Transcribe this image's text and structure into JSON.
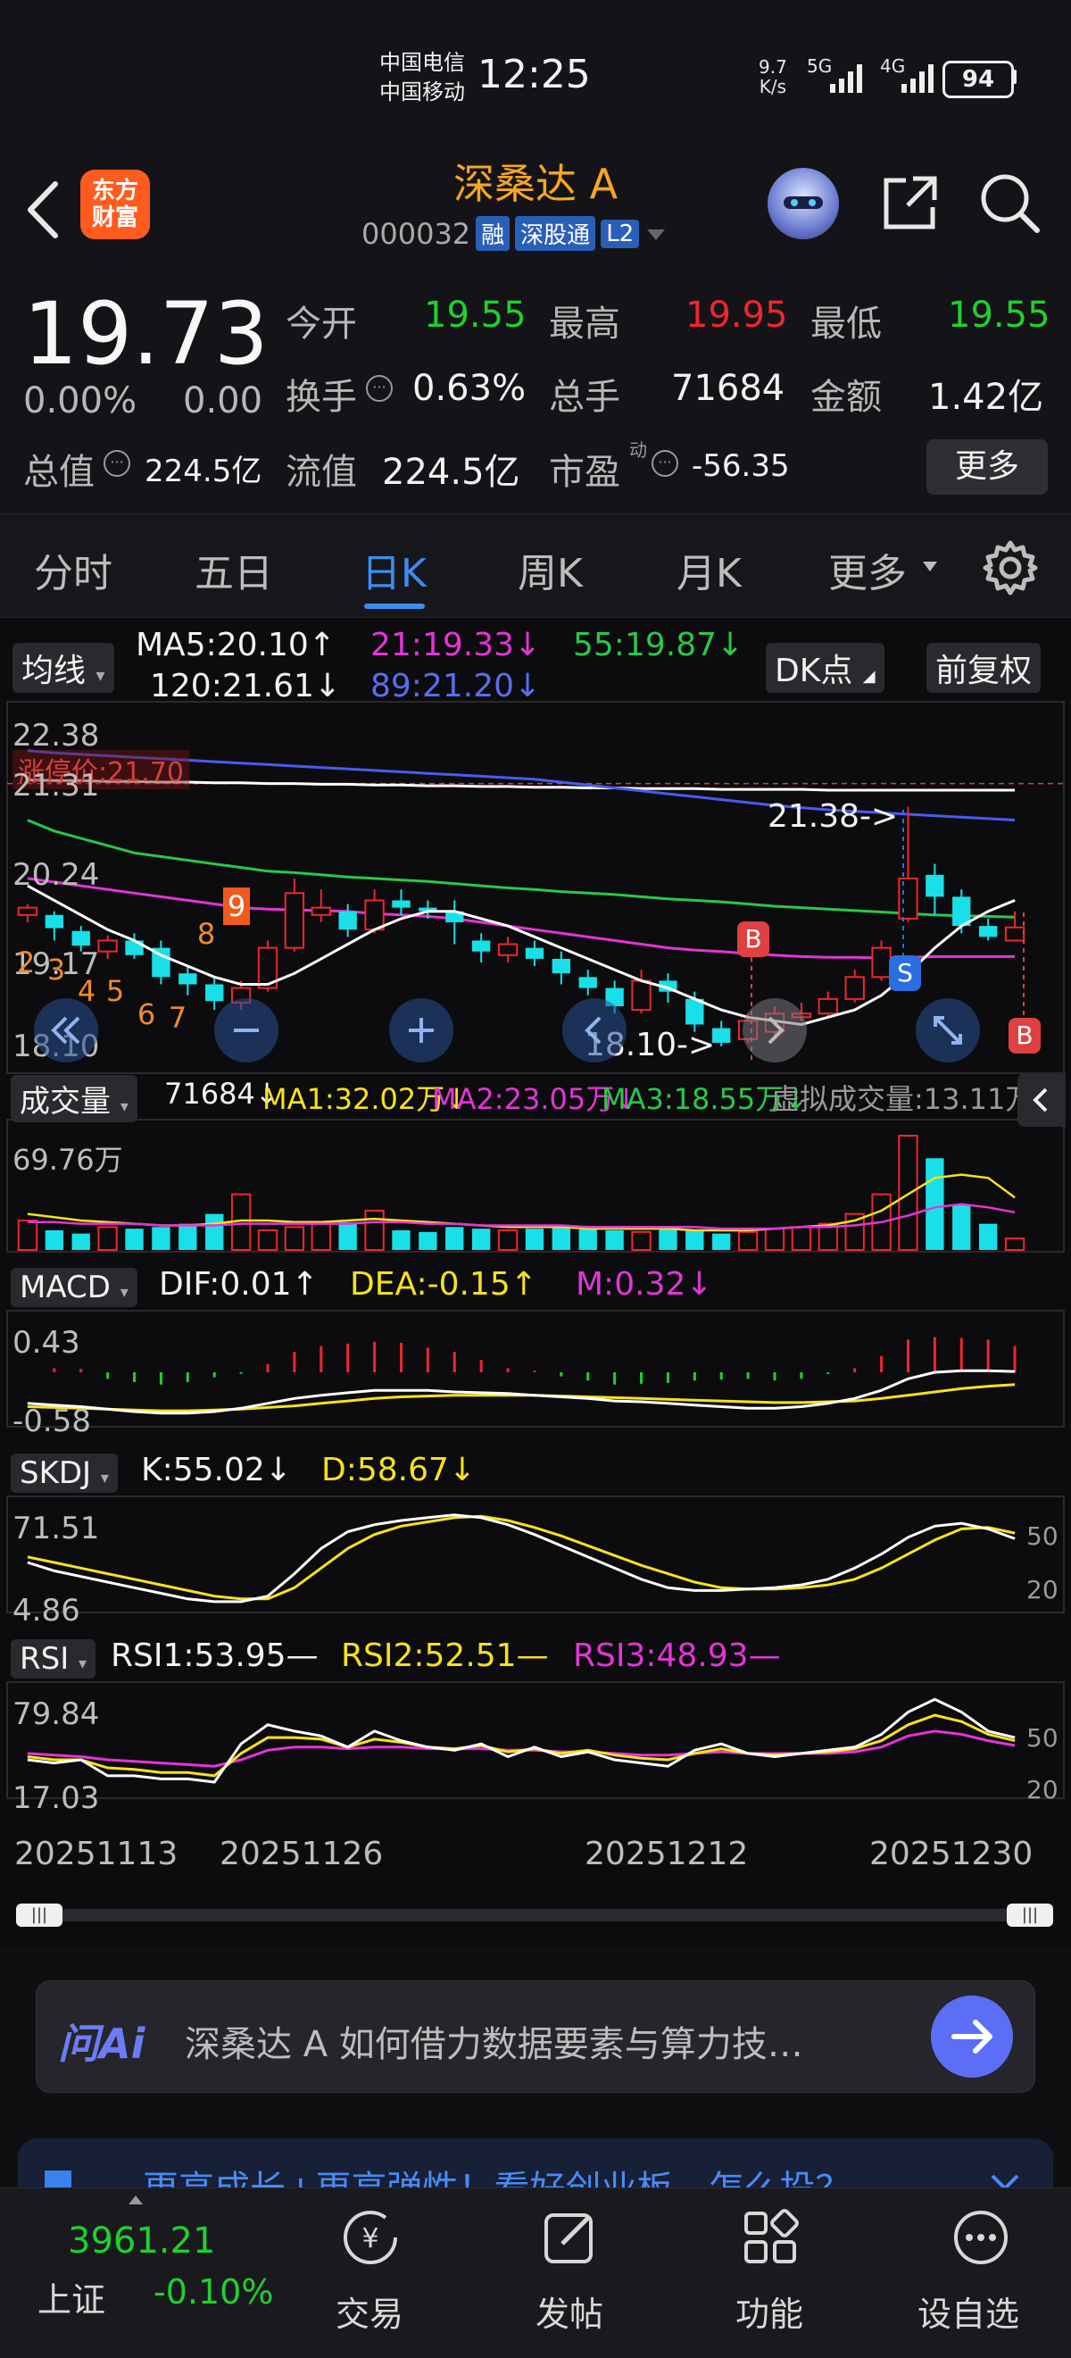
{
  "status": {
    "carrier1": "中国电信",
    "carrier2": "中国移动",
    "time": "12:25",
    "speed_top": "9.7",
    "speed_bottom": "K/s",
    "net1": "5G",
    "net2": "4G",
    "battery": "94"
  },
  "header": {
    "back_icon": "chevron-left-icon",
    "logo_line1": "东方",
    "logo_line2": "财富",
    "title": "深桑达 A",
    "code": "000032",
    "tags": [
      "融",
      "深股通",
      "L2"
    ]
  },
  "quote": {
    "price": "19.73",
    "change_pct": "0.00%",
    "change": "0.00",
    "open_label": "今开",
    "open": "19.55",
    "high_label": "最高",
    "high": "19.95",
    "low_label": "最低",
    "low": "19.55",
    "turnover_label": "换手",
    "turnover": "0.63%",
    "volume_label": "总手",
    "volume": "71684",
    "amount_label": "金额",
    "amount": "1.42亿",
    "mktcap_label": "总值",
    "mktcap": "224.5亿",
    "float_label": "流值",
    "float_cap": "224.5亿",
    "pe_label": "市盈",
    "pe_sup": "动",
    "pe": "-56.35",
    "more": "更多"
  },
  "tabs": [
    "分时",
    "五日",
    "日K",
    "周K",
    "月K",
    "更多"
  ],
  "active_tab": 2,
  "kline_legend": {
    "selector": "均线",
    "ma5": "MA5:20.10↑",
    "ma21": "21:19.33↓",
    "ma55": "55:19.87↓",
    "ma120": "120:21.61↓",
    "ma89": "89:21.20↓",
    "dk": "DK点",
    "adjust": "前复权",
    "limit_price": "涨停价:21.70",
    "y_labels": [
      "22.38",
      "21.31",
      "20.24",
      "19.17",
      "18.10"
    ],
    "annot_high": "21.38->",
    "annot_low": "18.10->",
    "seq_numbers": [
      "9",
      "8",
      "7",
      "6",
      "5",
      "4",
      "3",
      "2"
    ],
    "marker_b": "B",
    "marker_s": "S"
  },
  "volume_legend": {
    "selector": "成交量",
    "vol": "71684↓",
    "ma1": "MA1:32.02万↓",
    "ma2": "MA2:23.05万↓",
    "ma3": "MA3:18.55万↓",
    "virtual": "虚拟成交量:13.11万",
    "y_max": "69.76万"
  },
  "macd_legend": {
    "selector": "MACD",
    "dif": "DIF:0.01↑",
    "dea": "DEA:-0.15↑",
    "m": "M:0.32↓",
    "y_top": "0.43",
    "y_bottom": "-0.58"
  },
  "skdj_legend": {
    "selector": "SKDJ",
    "k": "K:55.02↓",
    "d": "D:58.67↓",
    "y_top": "71.51",
    "y_bottom": "4.86",
    "r50": "50",
    "r20": "20"
  },
  "rsi_legend": {
    "selector": "RSI",
    "rsi1": "RSI1:53.95—",
    "rsi2": "RSI2:52.51—",
    "rsi3": "RSI3:48.93—",
    "y_top": "79.84",
    "y_bottom": "17.03",
    "r50": "50",
    "r20": "20"
  },
  "dates": [
    "20251113",
    "20251126",
    "20251212",
    "20251230"
  ],
  "ai": {
    "logo": "问Ai",
    "prompt": "深桑达 A 如何借力数据要素与算力技…"
  },
  "banner": {
    "text": "更高成长+更高弹性！看好创业板，怎么投？"
  },
  "bottom_nav": {
    "index_value": "3961.21",
    "index_name": "上证",
    "index_change": "-0.10%",
    "items": [
      "交易",
      "发帖",
      "功能",
      "设自选"
    ]
  },
  "colors": {
    "up": "#f0262e",
    "down": "#19e0e8",
    "ma5": "#ffffff",
    "ma21": "#e335d6",
    "ma55": "#29c84a",
    "ma89": "#4a5bf0",
    "accent": "#3b8ef5",
    "title": "#f5a623"
  },
  "chart_data": {
    "type": "candlestick",
    "price_range": [
      18.1,
      22.38
    ],
    "candles": [
      {
        "o": 19.9,
        "c": 20.0,
        "h": 20.05,
        "l": 19.8
      },
      {
        "o": 19.9,
        "c": 19.72,
        "h": 19.95,
        "l": 19.55
      },
      {
        "o": 19.68,
        "c": 19.48,
        "h": 19.75,
        "l": 19.4
      },
      {
        "o": 19.4,
        "c": 19.55,
        "h": 19.62,
        "l": 19.3
      },
      {
        "o": 19.55,
        "c": 19.35,
        "h": 19.65,
        "l": 19.3
      },
      {
        "o": 19.45,
        "c": 19.05,
        "h": 19.55,
        "l": 18.95
      },
      {
        "o": 19.1,
        "c": 18.95,
        "h": 19.2,
        "l": 18.8
      },
      {
        "o": 18.95,
        "c": 18.72,
        "h": 19.05,
        "l": 18.6
      },
      {
        "o": 18.7,
        "c": 18.9,
        "h": 19.0,
        "l": 18.6
      },
      {
        "o": 18.9,
        "c": 19.45,
        "h": 19.55,
        "l": 18.85
      },
      {
        "o": 19.45,
        "c": 20.2,
        "h": 20.4,
        "l": 19.4
      },
      {
        "o": 19.9,
        "c": 20.0,
        "h": 20.25,
        "l": 19.8
      },
      {
        "o": 19.95,
        "c": 19.7,
        "h": 20.05,
        "l": 19.6
      },
      {
        "o": 19.7,
        "c": 20.1,
        "h": 20.25,
        "l": 19.65
      },
      {
        "o": 20.1,
        "c": 20.0,
        "h": 20.25,
        "l": 19.9
      },
      {
        "o": 20.0,
        "c": 19.95,
        "h": 20.1,
        "l": 19.85
      },
      {
        "o": 19.95,
        "c": 19.8,
        "h": 20.1,
        "l": 19.5
      },
      {
        "o": 19.55,
        "c": 19.4,
        "h": 19.65,
        "l": 19.25
      },
      {
        "o": 19.35,
        "c": 19.5,
        "h": 19.6,
        "l": 19.25
      },
      {
        "o": 19.45,
        "c": 19.3,
        "h": 19.55,
        "l": 19.2
      },
      {
        "o": 19.3,
        "c": 19.1,
        "h": 19.4,
        "l": 18.95
      },
      {
        "o": 19.05,
        "c": 18.9,
        "h": 19.15,
        "l": 18.8
      },
      {
        "o": 18.9,
        "c": 18.65,
        "h": 19.0,
        "l": 18.55
      },
      {
        "o": 18.6,
        "c": 19.0,
        "h": 19.15,
        "l": 18.55
      },
      {
        "o": 19.0,
        "c": 18.85,
        "h": 19.1,
        "l": 18.7
      },
      {
        "o": 18.75,
        "c": 18.4,
        "h": 18.85,
        "l": 18.3
      },
      {
        "o": 18.35,
        "c": 18.15,
        "h": 18.45,
        "l": 18.1
      },
      {
        "o": 18.2,
        "c": 18.45,
        "h": 18.55,
        "l": 18.15
      },
      {
        "o": 18.3,
        "c": 18.55,
        "h": 18.65,
        "l": 18.25
      },
      {
        "o": 18.5,
        "c": 18.55,
        "h": 18.7,
        "l": 18.45
      },
      {
        "o": 18.55,
        "c": 18.75,
        "h": 18.85,
        "l": 18.5
      },
      {
        "o": 18.75,
        "c": 19.05,
        "h": 19.15,
        "l": 18.7
      },
      {
        "o": 19.05,
        "c": 19.45,
        "h": 19.55,
        "l": 19.0
      },
      {
        "o": 19.85,
        "c": 20.4,
        "h": 21.38,
        "l": 19.8
      },
      {
        "o": 20.45,
        "c": 20.15,
        "h": 20.6,
        "l": 19.9
      },
      {
        "o": 20.15,
        "c": 19.75,
        "h": 20.25,
        "l": 19.65
      },
      {
        "o": 19.75,
        "c": 19.6,
        "h": 19.85,
        "l": 19.55
      },
      {
        "o": 19.55,
        "c": 19.73,
        "h": 19.95,
        "l": 19.55
      }
    ],
    "ma5": [
      20.3,
      20.1,
      19.9,
      19.7,
      19.55,
      19.35,
      19.2,
      19.05,
      18.95,
      18.95,
      19.1,
      19.3,
      19.5,
      19.7,
      19.85,
      19.95,
      19.95,
      19.85,
      19.75,
      19.6,
      19.45,
      19.3,
      19.15,
      19.0,
      18.9,
      18.75,
      18.6,
      18.5,
      18.45,
      18.4,
      18.5,
      18.6,
      18.8,
      19.1,
      19.45,
      19.75,
      19.95,
      20.1
    ],
    "ma21": [
      20.4,
      20.35,
      20.3,
      20.25,
      20.2,
      20.15,
      20.1,
      20.05,
      20.0,
      19.98,
      19.97,
      19.96,
      19.95,
      19.92,
      19.9,
      19.88,
      19.85,
      19.8,
      19.75,
      19.7,
      19.65,
      19.6,
      19.55,
      19.5,
      19.45,
      19.42,
      19.4,
      19.37,
      19.35,
      19.33,
      19.32,
      19.32,
      19.31,
      19.32,
      19.33,
      19.33,
      19.33,
      19.33
    ],
    "ma55": [
      21.2,
      21.05,
      20.95,
      20.85,
      20.75,
      20.7,
      20.65,
      20.6,
      20.55,
      20.5,
      20.48,
      20.45,
      20.42,
      20.4,
      20.38,
      20.36,
      20.33,
      20.3,
      20.27,
      20.25,
      20.22,
      20.2,
      20.18,
      20.15,
      20.12,
      20.1,
      20.08,
      20.05,
      20.02,
      20.0,
      19.98,
      19.96,
      19.94,
      19.92,
      19.9,
      19.89,
      19.88,
      19.87
    ],
    "ma89": [
      22.15,
      22.12,
      22.1,
      22.08,
      22.06,
      22.04,
      22.02,
      22.0,
      21.98,
      21.96,
      21.94,
      21.92,
      21.9,
      21.88,
      21.86,
      21.84,
      21.82,
      21.8,
      21.78,
      21.76,
      21.72,
      21.68,
      21.64,
      21.6,
      21.56,
      21.52,
      21.48,
      21.44,
      21.4,
      21.37,
      21.34,
      21.32,
      21.3,
      21.28,
      21.26,
      21.24,
      21.22,
      21.2
    ],
    "ma120": [
      21.75,
      21.74,
      21.74,
      21.73,
      21.73,
      21.72,
      21.72,
      21.71,
      21.71,
      21.7,
      21.7,
      21.69,
      21.69,
      21.68,
      21.68,
      21.67,
      21.67,
      21.66,
      21.66,
      21.65,
      21.65,
      21.64,
      21.64,
      21.63,
      21.63,
      21.63,
      21.62,
      21.62,
      21.62,
      21.62,
      21.61,
      21.61,
      21.61,
      21.61,
      21.61,
      21.61,
      21.61,
      21.61
    ],
    "volume": [
      18,
      12,
      10,
      14,
      13,
      14,
      16,
      22,
      34,
      12,
      14,
      16,
      17,
      24,
      12,
      11,
      14,
      13,
      12,
      13,
      14,
      14,
      12,
      11,
      13,
      12,
      10,
      11,
      13,
      14,
      16,
      22,
      34,
      69.76,
      56,
      28,
      16,
      7
    ],
    "vol_ma1": [
      22,
      20,
      18,
      17,
      16,
      15,
      15,
      16,
      18,
      18,
      17,
      17,
      18,
      19,
      18,
      17,
      16,
      15,
      14,
      14,
      14,
      13,
      13,
      13,
      13,
      12,
      12,
      12,
      13,
      14,
      15,
      18,
      24,
      34,
      44,
      46,
      44,
      32
    ],
    "vol_ma2": [
      17,
      17,
      16,
      16,
      16,
      15,
      15,
      15,
      16,
      16,
      16,
      16,
      16,
      17,
      17,
      16,
      16,
      15,
      15,
      15,
      15,
      14,
      14,
      14,
      14,
      14,
      13,
      13,
      13,
      14,
      14,
      15,
      17,
      21,
      26,
      28,
      26,
      23
    ],
    "macd_bar": [
      0.0,
      0.05,
      0.04,
      -0.08,
      -0.12,
      -0.15,
      -0.12,
      -0.06,
      -0.02,
      0.1,
      0.25,
      0.32,
      0.35,
      0.37,
      0.36,
      0.3,
      0.25,
      0.15,
      0.05,
      0.02,
      -0.05,
      -0.1,
      -0.15,
      -0.14,
      -0.13,
      -0.1,
      -0.09,
      -0.08,
      -0.1,
      -0.08,
      -0.02,
      0.05,
      0.2,
      0.4,
      0.43,
      0.42,
      0.4,
      0.32
    ],
    "macd_dif": [
      -0.38,
      -0.4,
      -0.42,
      -0.45,
      -0.48,
      -0.5,
      -0.5,
      -0.48,
      -0.44,
      -0.38,
      -0.32,
      -0.28,
      -0.25,
      -0.22,
      -0.22,
      -0.22,
      -0.24,
      -0.25,
      -0.26,
      -0.28,
      -0.3,
      -0.32,
      -0.35,
      -0.36,
      -0.38,
      -0.4,
      -0.42,
      -0.44,
      -0.44,
      -0.42,
      -0.38,
      -0.32,
      -0.22,
      -0.08,
      0.0,
      0.02,
      0.02,
      0.01
    ],
    "macd_dea": [
      -0.42,
      -0.43,
      -0.44,
      -0.45,
      -0.46,
      -0.47,
      -0.47,
      -0.46,
      -0.45,
      -0.43,
      -0.41,
      -0.38,
      -0.35,
      -0.32,
      -0.3,
      -0.29,
      -0.28,
      -0.28,
      -0.28,
      -0.28,
      -0.29,
      -0.3,
      -0.31,
      -0.32,
      -0.33,
      -0.34,
      -0.35,
      -0.36,
      -0.37,
      -0.37,
      -0.36,
      -0.35,
      -0.32,
      -0.28,
      -0.24,
      -0.2,
      -0.17,
      -0.15
    ],
    "skdj_k": [
      38,
      32,
      28,
      24,
      20,
      16,
      12,
      10,
      10,
      14,
      30,
      48,
      60,
      65,
      68,
      70,
      72,
      70,
      65,
      58,
      50,
      42,
      34,
      26,
      20,
      18,
      18,
      19,
      20,
      22,
      26,
      34,
      44,
      56,
      64,
      66,
      62,
      55
    ],
    "skdj_d": [
      42,
      38,
      34,
      30,
      26,
      22,
      18,
      14,
      12,
      12,
      20,
      34,
      48,
      58,
      64,
      67,
      70,
      71,
      68,
      63,
      57,
      50,
      43,
      36,
      30,
      24,
      20,
      19,
      19,
      20,
      22,
      26,
      34,
      44,
      54,
      62,
      63,
      59
    ],
    "rsi1": [
      40,
      38,
      40,
      30,
      30,
      28,
      28,
      26,
      50,
      62,
      58,
      55,
      48,
      58,
      52,
      48,
      46,
      50,
      42,
      48,
      42,
      45,
      40,
      38,
      36,
      46,
      50,
      44,
      42,
      44,
      46,
      48,
      56,
      70,
      78,
      70,
      58,
      54
    ],
    "rsi2": [
      42,
      40,
      40,
      35,
      34,
      32,
      32,
      30,
      44,
      54,
      54,
      53,
      48,
      53,
      51,
      48,
      47,
      49,
      45,
      47,
      44,
      46,
      43,
      41,
      40,
      44,
      47,
      44,
      43,
      44,
      45,
      47,
      52,
      62,
      68,
      64,
      56,
      52
    ],
    "rsi3": [
      44,
      43,
      42,
      40,
      39,
      38,
      37,
      36,
      40,
      46,
      48,
      48,
      47,
      48,
      48,
      47,
      47,
      47,
      46,
      46,
      45,
      45,
      44,
      43,
      43,
      44,
      45,
      44,
      44,
      44,
      44,
      45,
      48,
      55,
      58,
      56,
      52,
      49
    ]
  }
}
